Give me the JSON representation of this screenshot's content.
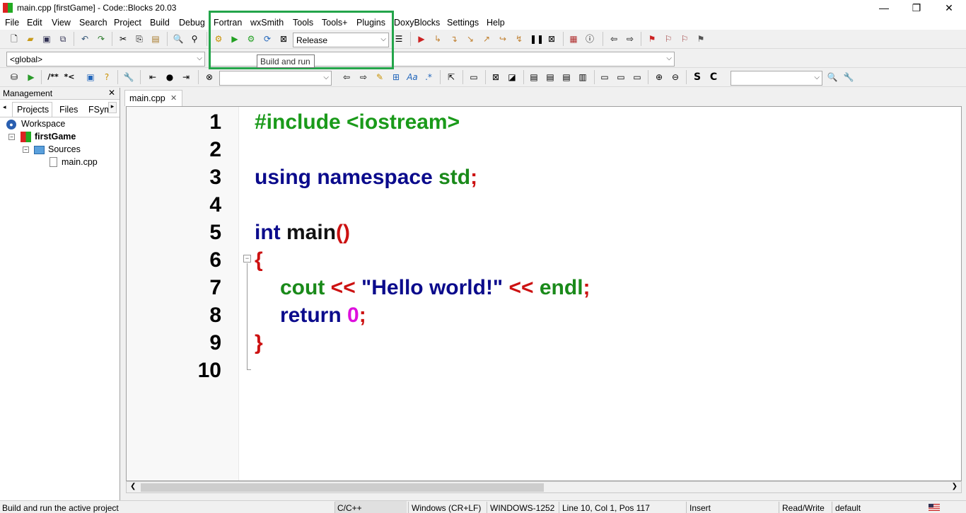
{
  "window": {
    "title": "main.cpp [firstGame] - Code::Blocks 20.03",
    "controls": [
      "minimize-icon",
      "restore-icon",
      "close-icon"
    ]
  },
  "menu": [
    "File",
    "Edit",
    "View",
    "Search",
    "Project",
    "Build",
    "Debug",
    "Fortran",
    "wxSmith",
    "Tools",
    "Tools+",
    "Plugins",
    "DoxyBlocks",
    "Settings",
    "Help"
  ],
  "toolbar": {
    "build_target": "Release",
    "scope": "<global>",
    "tooltip": "Build and run"
  },
  "management": {
    "title": "Management",
    "close": "✕",
    "tabs": [
      "Projects",
      "Files",
      "FSym"
    ],
    "tree": {
      "workspace": "Workspace",
      "project": "firstGame",
      "folder": "Sources",
      "file": "main.cpp"
    }
  },
  "editor": {
    "tab_label": "main.cpp",
    "tab_close": "✕",
    "line_numbers": [
      "1",
      "2",
      "3",
      "4",
      "5",
      "6",
      "7",
      "8",
      "9",
      "10"
    ],
    "lines": {
      "l1": "#include <iostream>",
      "l3_kw": "using namespace ",
      "l3_id": "std",
      "l3_semi": ";",
      "l5_kw": "int ",
      "l5_id": "main",
      "l5_paren": "()",
      "l6": "{",
      "l7_cout": "cout ",
      "l7_op1": "<< ",
      "l7_str": "\"Hello world!\" ",
      "l7_op2": "<< ",
      "l7_endl": "endl",
      "l7_semi": ";",
      "l8_kw": "return ",
      "l8_num": "0",
      "l8_semi": ";",
      "l9": "}"
    }
  },
  "status": {
    "message": "Build and run the active project",
    "language": "C/C++",
    "eol": "Windows (CR+LF)",
    "encoding": "WINDOWS-1252",
    "position": "Line 10, Col 1, Pos 117",
    "mode": "Insert",
    "access": "Read/Write",
    "profile": "default"
  },
  "colors": {
    "highlight_box": "#23a54a",
    "preprocessor": "#1a9a1a",
    "keyword": "#0b0b8c",
    "operator": "#cc1111",
    "number": "#dd10dd"
  }
}
